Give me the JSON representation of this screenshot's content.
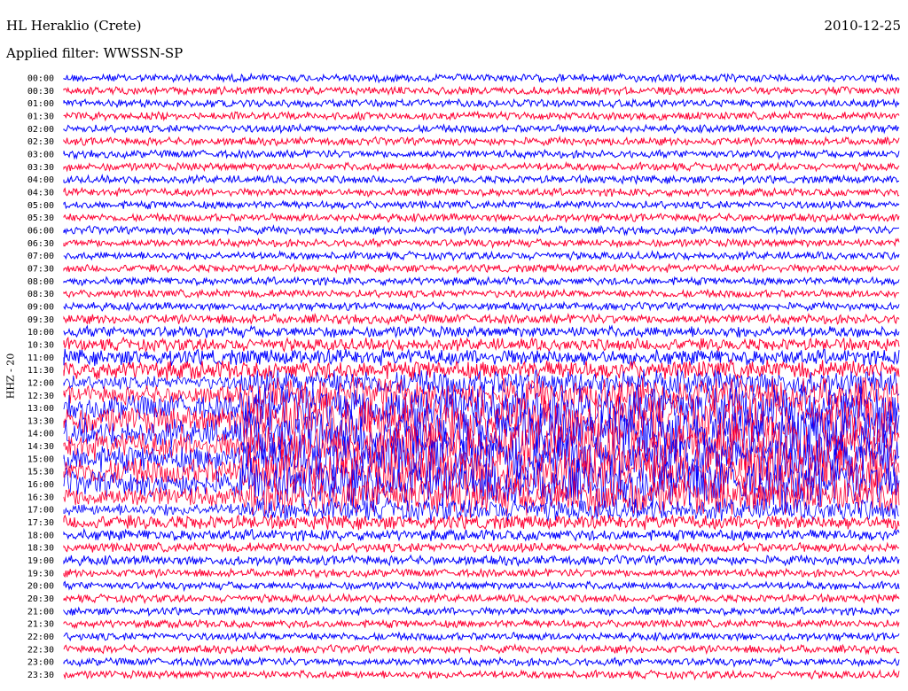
{
  "header": {
    "station": "HL Heraklio (Crete)",
    "date": "2010-12-25",
    "filter": "Applied filter: WWSSN-SP",
    "channel": "HHZ - 20"
  },
  "chart_data": {
    "type": "line",
    "title": "HL Heraklio (Crete)",
    "date": "2010-12-25",
    "channel_label": "HHZ - 20",
    "row_labels": [
      "00:00",
      "00:30",
      "01:00",
      "01:30",
      "02:00",
      "02:30",
      "03:00",
      "03:30",
      "04:00",
      "04:30",
      "05:00",
      "05:30",
      "06:00",
      "06:30",
      "07:00",
      "07:30",
      "08:00",
      "08:30",
      "09:00",
      "09:30",
      "10:00",
      "10:30",
      "11:00",
      "11:30",
      "12:00",
      "12:30",
      "13:00",
      "13:30",
      "14:00",
      "14:30",
      "15:00",
      "15:30",
      "16:00",
      "16:30",
      "17:00",
      "17:30",
      "18:00",
      "18:30",
      "19:00",
      "19:30",
      "20:00",
      "20:30",
      "21:00",
      "21:30",
      "22:00",
      "22:30",
      "23:00",
      "23:30"
    ],
    "colors": [
      "#0000ff",
      "#ff0033"
    ],
    "row_amplitude": [
      5,
      5,
      5,
      5,
      5,
      5,
      5,
      5,
      5,
      5,
      5,
      5,
      5,
      5,
      5,
      5,
      5,
      5,
      5,
      6,
      7,
      8,
      10,
      12,
      16,
      22,
      30,
      32,
      32,
      32,
      32,
      32,
      30,
      24,
      14,
      9,
      7,
      6,
      6,
      5,
      5,
      5,
      5,
      5,
      5,
      5,
      5,
      5
    ],
    "grid": false
  }
}
